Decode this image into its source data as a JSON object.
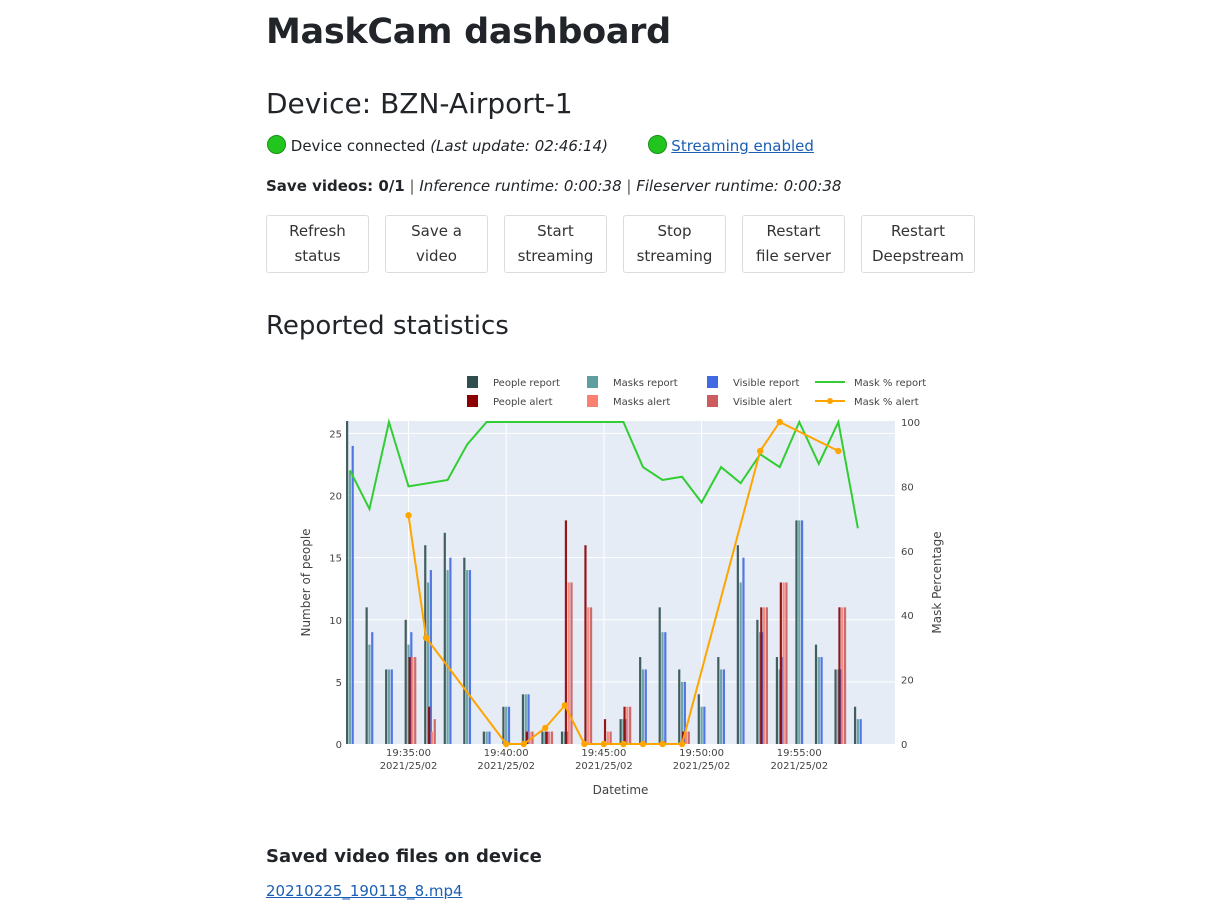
{
  "page": {
    "title": "MaskCam dashboard"
  },
  "device": {
    "heading": "Device: BZN-Airport-1",
    "connected_text": "Device connected",
    "last_update": "(Last update: 02:46:14)",
    "streaming_text": "Streaming enabled",
    "status_color": "#22c51e"
  },
  "runtime": {
    "save_label": "Save videos: 0/1",
    "sep": " | ",
    "inference": "Inference runtime: 0:00:38",
    "fileserver": "Fileserver runtime: 0:00:38"
  },
  "buttons": [
    {
      "line1": "Refresh",
      "line2": "status"
    },
    {
      "line1": "Save a",
      "line2": "video"
    },
    {
      "line1": "Start",
      "line2": "streaming"
    },
    {
      "line1": "Stop",
      "line2": "streaming"
    },
    {
      "line1": "Restart",
      "line2": "file server"
    },
    {
      "line1": "Restart",
      "line2": "Deepstream"
    }
  ],
  "stats": {
    "heading": "Reported statistics"
  },
  "chart_data": {
    "type": "bar",
    "title": "",
    "xlabel": "Datetime",
    "ylabel": "Number of people",
    "y2label": "Mask Percentage",
    "ylim": [
      0,
      26
    ],
    "y2lim": [
      0,
      100
    ],
    "y_ticks": [
      0,
      5,
      10,
      15,
      20,
      25
    ],
    "y2_ticks": [
      0,
      20,
      40,
      60,
      80,
      100
    ],
    "x_ticks": [
      {
        "t": 35,
        "label1": "19:35:00",
        "label2": "2021/25/02"
      },
      {
        "t": 40,
        "label1": "19:40:00",
        "label2": "2021/25/02"
      },
      {
        "t": 45,
        "label1": "19:45:00",
        "label2": "2021/25/02"
      },
      {
        "t": 50,
        "label1": "19:50:00",
        "label2": "2021/25/02"
      },
      {
        "t": 55,
        "label1": "19:55:00",
        "label2": "2021/25/02"
      }
    ],
    "xlim": [
      31.8,
      59.9
    ],
    "grid": true,
    "legend_position": "top",
    "legend": [
      {
        "name": "People report",
        "kind": "bar",
        "color": "#2f4f4f"
      },
      {
        "name": "Masks report",
        "kind": "bar",
        "color": "#5f9ea0"
      },
      {
        "name": "Visible report",
        "kind": "bar",
        "color": "#4169e1"
      },
      {
        "name": "Mask % report",
        "kind": "line",
        "color": "#32cd32"
      },
      {
        "name": "People alert",
        "kind": "bar",
        "color": "#8b0000"
      },
      {
        "name": "Masks alert",
        "kind": "bar",
        "color": "#fa8072"
      },
      {
        "name": "Visible alert",
        "kind": "bar",
        "color": "#cd5c5c"
      },
      {
        "name": "Mask % alert",
        "kind": "line-marker",
        "color": "#ffa500"
      }
    ],
    "report_bars": [
      {
        "t": 32.0,
        "people": 26,
        "masks": 22,
        "visible": 24
      },
      {
        "t": 33.0,
        "people": 11,
        "masks": 8,
        "visible": 9
      },
      {
        "t": 34.0,
        "people": 6,
        "masks": 6,
        "visible": 6
      },
      {
        "t": 35.0,
        "people": 10,
        "masks": 8,
        "visible": 9
      },
      {
        "t": 36.0,
        "people": 16,
        "masks": 13,
        "visible": 14
      },
      {
        "t": 37.0,
        "people": 17,
        "masks": 14,
        "visible": 15
      },
      {
        "t": 38.0,
        "people": 15,
        "masks": 14,
        "visible": 14
      },
      {
        "t": 39.0,
        "people": 1,
        "masks": 1,
        "visible": 1
      },
      {
        "t": 40.0,
        "people": 3,
        "masks": 3,
        "visible": 3
      },
      {
        "t": 41.0,
        "people": 4,
        "masks": 4,
        "visible": 4
      },
      {
        "t": 42.0,
        "people": 1,
        "masks": 1,
        "visible": 1
      },
      {
        "t": 43.0,
        "people": 1,
        "masks": 1,
        "visible": 1
      },
      {
        "t": 46.0,
        "people": 2,
        "masks": 2,
        "visible": 2
      },
      {
        "t": 47.0,
        "people": 7,
        "masks": 6,
        "visible": 6
      },
      {
        "t": 48.0,
        "people": 11,
        "masks": 9,
        "visible": 9
      },
      {
        "t": 49.0,
        "people": 6,
        "masks": 5,
        "visible": 5
      },
      {
        "t": 50.0,
        "people": 4,
        "masks": 3,
        "visible": 3
      },
      {
        "t": 51.0,
        "people": 7,
        "masks": 6,
        "visible": 6
      },
      {
        "t": 52.0,
        "people": 16,
        "masks": 13,
        "visible": 15
      },
      {
        "t": 53.0,
        "people": 10,
        "masks": 9,
        "visible": 9
      },
      {
        "t": 54.0,
        "people": 7,
        "masks": 6,
        "visible": 7
      },
      {
        "t": 55.0,
        "people": 18,
        "masks": 18,
        "visible": 18
      },
      {
        "t": 56.0,
        "people": 8,
        "masks": 7,
        "visible": 7
      },
      {
        "t": 57.0,
        "people": 6,
        "masks": 6,
        "visible": 6
      },
      {
        "t": 58.0,
        "people": 3,
        "masks": 2,
        "visible": 2
      }
    ],
    "alert_bars": [
      {
        "t": 35.2,
        "people": 7,
        "masks": 7,
        "visible": 7
      },
      {
        "t": 36.2,
        "people": 3,
        "masks": 1,
        "visible": 2
      },
      {
        "t": 41.2,
        "people": 1,
        "masks": 1,
        "visible": 1
      },
      {
        "t": 42.2,
        "people": 1,
        "masks": 1,
        "visible": 1
      },
      {
        "t": 43.2,
        "people": 18,
        "masks": 13,
        "visible": 13
      },
      {
        "t": 44.2,
        "people": 16,
        "masks": 11,
        "visible": 11
      },
      {
        "t": 45.2,
        "people": 2,
        "masks": 1,
        "visible": 1
      },
      {
        "t": 46.2,
        "people": 3,
        "masks": 3,
        "visible": 3
      },
      {
        "t": 49.2,
        "people": 1,
        "masks": 1,
        "visible": 1
      },
      {
        "t": 53.2,
        "people": 11,
        "masks": 11,
        "visible": 11
      },
      {
        "t": 54.2,
        "people": 13,
        "masks": 13,
        "visible": 13
      },
      {
        "t": 57.2,
        "people": 11,
        "masks": 11,
        "visible": 11
      }
    ],
    "mask_pct_report": [
      {
        "t": 32.0,
        "v": 85
      },
      {
        "t": 33.0,
        "v": 73
      },
      {
        "t": 34.0,
        "v": 100
      },
      {
        "t": 35.0,
        "v": 80
      },
      {
        "t": 36.0,
        "v": 81
      },
      {
        "t": 37.0,
        "v": 82
      },
      {
        "t": 38.0,
        "v": 93
      },
      {
        "t": 39.0,
        "v": 100
      },
      {
        "t": 40.0,
        "v": 100
      },
      {
        "t": 41.0,
        "v": 100
      },
      {
        "t": 42.0,
        "v": 100
      },
      {
        "t": 43.0,
        "v": 100
      },
      {
        "t": 44.0,
        "v": 100
      },
      {
        "t": 45.0,
        "v": 100
      },
      {
        "t": 46.0,
        "v": 100
      },
      {
        "t": 47.0,
        "v": 86
      },
      {
        "t": 48.0,
        "v": 82
      },
      {
        "t": 49.0,
        "v": 83
      },
      {
        "t": 50.0,
        "v": 75
      },
      {
        "t": 51.0,
        "v": 86
      },
      {
        "t": 52.0,
        "v": 81
      },
      {
        "t": 53.0,
        "v": 90
      },
      {
        "t": 54.0,
        "v": 86
      },
      {
        "t": 55.0,
        "v": 100
      },
      {
        "t": 56.0,
        "v": 87
      },
      {
        "t": 57.0,
        "v": 100
      },
      {
        "t": 58.0,
        "v": 67
      }
    ],
    "mask_pct_alert": [
      {
        "t": 35.0,
        "v": 71
      },
      {
        "t": 35.9,
        "v": 33
      },
      {
        "t": 40.0,
        "v": 0
      },
      {
        "t": 40.9,
        "v": 0
      },
      {
        "t": 42.0,
        "v": 5
      },
      {
        "t": 43.0,
        "v": 12
      },
      {
        "t": 44.0,
        "v": 0
      },
      {
        "t": 45.0,
        "v": 0
      },
      {
        "t": 46.0,
        "v": 0
      },
      {
        "t": 47.0,
        "v": 0
      },
      {
        "t": 48.0,
        "v": 0
      },
      {
        "t": 49.0,
        "v": 0
      },
      {
        "t": 53.0,
        "v": 91
      },
      {
        "t": 54.0,
        "v": 100
      },
      {
        "t": 57.0,
        "v": 91
      }
    ]
  },
  "files": {
    "heading": "Saved video files on device",
    "items": [
      "20210225_190118_8.mp4"
    ]
  }
}
